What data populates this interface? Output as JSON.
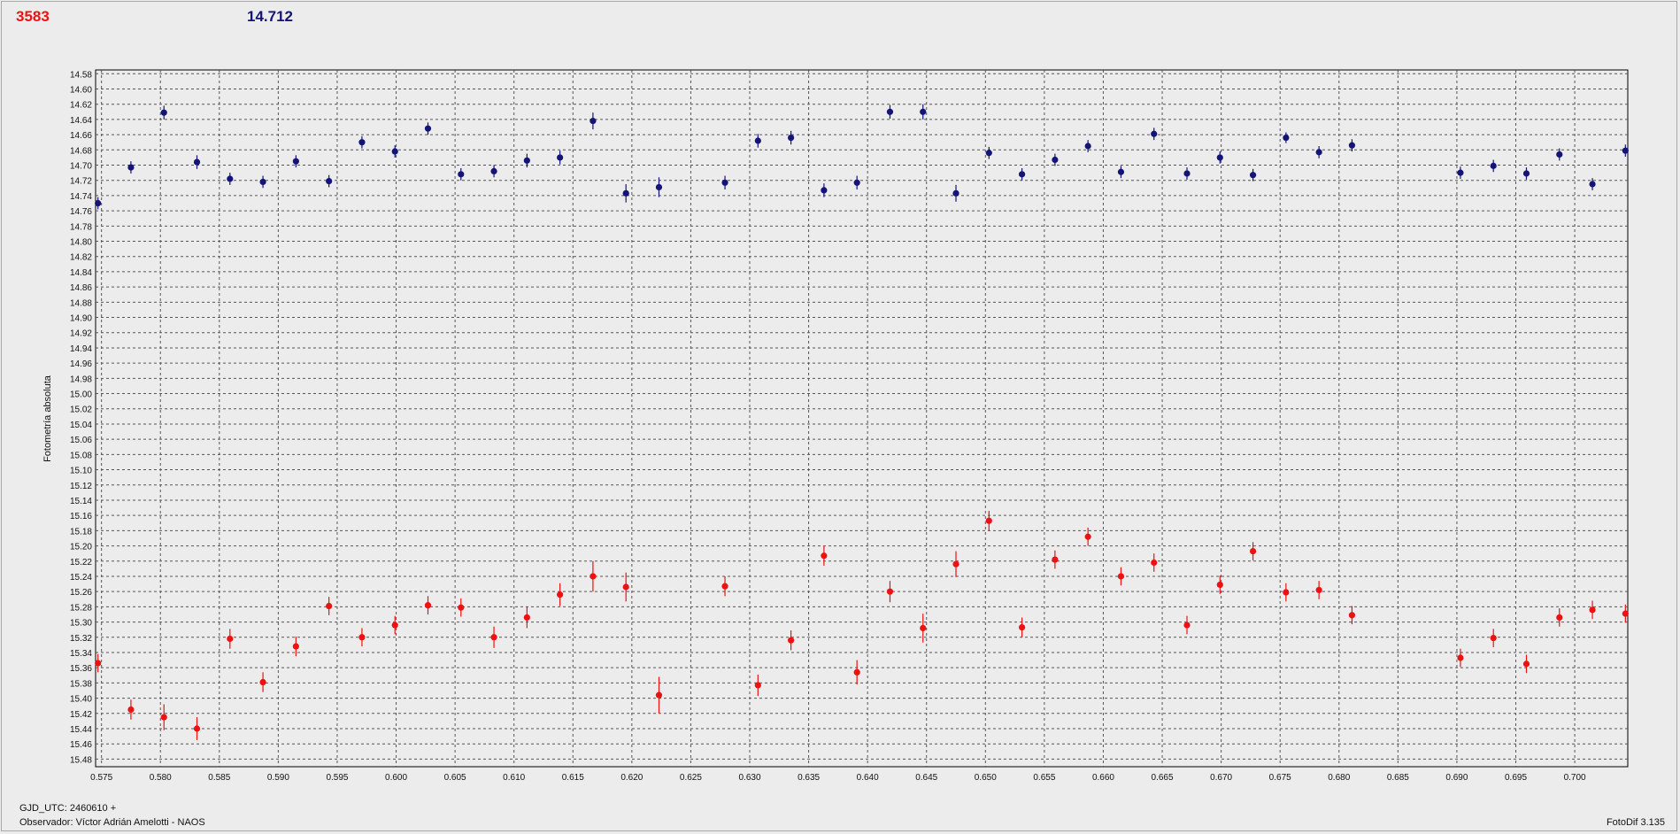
{
  "header": {
    "left_value": "3583",
    "right_value": "14.712"
  },
  "footer": {
    "gjd": "GJD_UTC: 2460610 +",
    "observer": "Observador: Víctor Adrián Amelotti - NAOS",
    "version": "FotoDif 3.135"
  },
  "colors": {
    "series_blue": "#141478",
    "series_red": "#ee1111",
    "grid": "#555555",
    "background": "#ececec"
  },
  "chart_data": {
    "type": "scatter",
    "ylabel": "Fotometría absoluta",
    "xlabel": "",
    "xlim": [
      0.5745,
      0.7045
    ],
    "ylim": [
      15.49,
      14.575
    ],
    "y_inverted": true,
    "grid": true,
    "x_ticks": [
      0.575,
      0.58,
      0.585,
      0.59,
      0.595,
      0.6,
      0.605,
      0.61,
      0.615,
      0.62,
      0.625,
      0.63,
      0.635,
      0.64,
      0.645,
      0.65,
      0.655,
      0.66,
      0.665,
      0.67,
      0.675,
      0.68,
      0.685,
      0.69,
      0.695,
      0.7
    ],
    "x_tick_labels": [
      "0.575",
      "0.580",
      "0.585",
      "0.590",
      "0.595",
      "0.600",
      "0.605",
      "0.610",
      "0.615",
      "0.620",
      "0.625",
      "0.630",
      "0.635",
      "0.640",
      "0.645",
      "0.650",
      "0.655",
      "0.660",
      "0.665",
      "0.670",
      "0.675",
      "0.680",
      "0.685",
      "0.690",
      "0.695",
      "0.700"
    ],
    "y_ticks": [
      14.58,
      14.6,
      14.62,
      14.64,
      14.66,
      14.68,
      14.7,
      14.72,
      14.74,
      14.76,
      14.78,
      14.8,
      14.82,
      14.84,
      14.86,
      14.88,
      14.9,
      14.92,
      14.94,
      14.96,
      14.98,
      15.0,
      15.02,
      15.04,
      15.06,
      15.08,
      15.1,
      15.12,
      15.14,
      15.16,
      15.18,
      15.2,
      15.22,
      15.24,
      15.26,
      15.28,
      15.3,
      15.32,
      15.34,
      15.36,
      15.38,
      15.4,
      15.42,
      15.44,
      15.46,
      15.48
    ],
    "y_tick_labels": [
      "14.58",
      "14.60",
      "14.62",
      "14.64",
      "14.66",
      "14.68",
      "14.70",
      "14.72",
      "14.74",
      "14.76",
      "14.78",
      "14.80",
      "14.82",
      "14.84",
      "14.86",
      "14.88",
      "14.90",
      "14.92",
      "14.94",
      "14.96",
      "14.98",
      "15.00",
      "15.02",
      "15.04",
      "15.06",
      "15.08",
      "15.10",
      "15.12",
      "15.14",
      "15.16",
      "15.18",
      "15.20",
      "15.22",
      "15.24",
      "15.26",
      "15.28",
      "15.30",
      "15.32",
      "15.34",
      "15.36",
      "15.38",
      "15.40",
      "15.42",
      "15.44",
      "15.46",
      "15.48"
    ],
    "series": [
      {
        "color": "#141478",
        "points": [
          {
            "x": 0.5747,
            "y": 14.75,
            "err": 0.008
          },
          {
            "x": 0.5775,
            "y": 14.703,
            "err": 0.008
          },
          {
            "x": 0.5803,
            "y": 14.631,
            "err": 0.009
          },
          {
            "x": 0.5831,
            "y": 14.696,
            "err": 0.009
          },
          {
            "x": 0.5859,
            "y": 14.718,
            "err": 0.008
          },
          {
            "x": 0.5887,
            "y": 14.722,
            "err": 0.008
          },
          {
            "x": 0.5915,
            "y": 14.695,
            "err": 0.008
          },
          {
            "x": 0.5943,
            "y": 14.721,
            "err": 0.008
          },
          {
            "x": 0.5971,
            "y": 14.67,
            "err": 0.008
          },
          {
            "x": 0.5999,
            "y": 14.682,
            "err": 0.008
          },
          {
            "x": 0.6027,
            "y": 14.652,
            "err": 0.008
          },
          {
            "x": 0.6055,
            "y": 14.712,
            "err": 0.008
          },
          {
            "x": 0.6083,
            "y": 14.708,
            "err": 0.008
          },
          {
            "x": 0.6111,
            "y": 14.694,
            "err": 0.009
          },
          {
            "x": 0.6139,
            "y": 14.69,
            "err": 0.009
          },
          {
            "x": 0.6167,
            "y": 14.642,
            "err": 0.011
          },
          {
            "x": 0.6195,
            "y": 14.737,
            "err": 0.012
          },
          {
            "x": 0.6223,
            "y": 14.729,
            "err": 0.013
          },
          {
            "x": 0.6279,
            "y": 14.723,
            "err": 0.009
          },
          {
            "x": 0.6307,
            "y": 14.668,
            "err": 0.009
          },
          {
            "x": 0.6335,
            "y": 14.664,
            "err": 0.009
          },
          {
            "x": 0.6363,
            "y": 14.733,
            "err": 0.009
          },
          {
            "x": 0.6391,
            "y": 14.723,
            "err": 0.009
          },
          {
            "x": 0.6419,
            "y": 14.63,
            "err": 0.009
          },
          {
            "x": 0.6447,
            "y": 14.63,
            "err": 0.01
          },
          {
            "x": 0.6475,
            "y": 14.737,
            "err": 0.011
          },
          {
            "x": 0.6503,
            "y": 14.684,
            "err": 0.008
          },
          {
            "x": 0.6531,
            "y": 14.712,
            "err": 0.008
          },
          {
            "x": 0.6559,
            "y": 14.693,
            "err": 0.008
          },
          {
            "x": 0.6587,
            "y": 14.675,
            "err": 0.008
          },
          {
            "x": 0.6615,
            "y": 14.709,
            "err": 0.008
          },
          {
            "x": 0.6643,
            "y": 14.659,
            "err": 0.008
          },
          {
            "x": 0.6671,
            "y": 14.711,
            "err": 0.008
          },
          {
            "x": 0.6699,
            "y": 14.69,
            "err": 0.008
          },
          {
            "x": 0.6727,
            "y": 14.713,
            "err": 0.008
          },
          {
            "x": 0.6755,
            "y": 14.664,
            "err": 0.007
          },
          {
            "x": 0.6783,
            "y": 14.683,
            "err": 0.008
          },
          {
            "x": 0.6811,
            "y": 14.674,
            "err": 0.008
          },
          {
            "x": 0.6903,
            "y": 14.71,
            "err": 0.008
          },
          {
            "x": 0.6931,
            "y": 14.701,
            "err": 0.008
          },
          {
            "x": 0.6959,
            "y": 14.711,
            "err": 0.008
          },
          {
            "x": 0.6987,
            "y": 14.686,
            "err": 0.008
          },
          {
            "x": 0.7015,
            "y": 14.725,
            "err": 0.008
          },
          {
            "x": 0.7043,
            "y": 14.681,
            "err": 0.008
          }
        ]
      },
      {
        "color": "#ee1111",
        "points": [
          {
            "x": 0.5747,
            "y": 15.354,
            "err": 0.012
          },
          {
            "x": 0.5775,
            "y": 15.415,
            "err": 0.013
          },
          {
            "x": 0.5803,
            "y": 15.425,
            "err": 0.017
          },
          {
            "x": 0.5831,
            "y": 15.44,
            "err": 0.015
          },
          {
            "x": 0.5859,
            "y": 15.322,
            "err": 0.013
          },
          {
            "x": 0.5887,
            "y": 15.379,
            "err": 0.013
          },
          {
            "x": 0.5915,
            "y": 15.332,
            "err": 0.013
          },
          {
            "x": 0.5943,
            "y": 15.279,
            "err": 0.012
          },
          {
            "x": 0.5971,
            "y": 15.32,
            "err": 0.012
          },
          {
            "x": 0.5999,
            "y": 15.304,
            "err": 0.012
          },
          {
            "x": 0.6027,
            "y": 15.278,
            "err": 0.012
          },
          {
            "x": 0.6055,
            "y": 15.281,
            "err": 0.012
          },
          {
            "x": 0.6083,
            "y": 15.32,
            "err": 0.014
          },
          {
            "x": 0.6111,
            "y": 15.294,
            "err": 0.014
          },
          {
            "x": 0.6139,
            "y": 15.264,
            "err": 0.015
          },
          {
            "x": 0.6167,
            "y": 15.24,
            "err": 0.02
          },
          {
            "x": 0.6195,
            "y": 15.254,
            "err": 0.019
          },
          {
            "x": 0.6223,
            "y": 15.396,
            "err": 0.024
          },
          {
            "x": 0.6279,
            "y": 15.253,
            "err": 0.013
          },
          {
            "x": 0.6307,
            "y": 15.383,
            "err": 0.014
          },
          {
            "x": 0.6335,
            "y": 15.324,
            "err": 0.013
          },
          {
            "x": 0.6363,
            "y": 15.213,
            "err": 0.013
          },
          {
            "x": 0.6391,
            "y": 15.366,
            "err": 0.016
          },
          {
            "x": 0.6419,
            "y": 15.26,
            "err": 0.014
          },
          {
            "x": 0.6447,
            "y": 15.308,
            "err": 0.019
          },
          {
            "x": 0.6475,
            "y": 15.224,
            "err": 0.017
          },
          {
            "x": 0.6503,
            "y": 15.167,
            "err": 0.013
          },
          {
            "x": 0.6531,
            "y": 15.307,
            "err": 0.013
          },
          {
            "x": 0.6559,
            "y": 15.218,
            "err": 0.012
          },
          {
            "x": 0.6587,
            "y": 15.188,
            "err": 0.012
          },
          {
            "x": 0.6615,
            "y": 15.24,
            "err": 0.012
          },
          {
            "x": 0.6643,
            "y": 15.222,
            "err": 0.012
          },
          {
            "x": 0.6671,
            "y": 15.304,
            "err": 0.012
          },
          {
            "x": 0.6699,
            "y": 15.251,
            "err": 0.012
          },
          {
            "x": 0.6727,
            "y": 15.207,
            "err": 0.012
          },
          {
            "x": 0.6755,
            "y": 15.261,
            "err": 0.012
          },
          {
            "x": 0.6783,
            "y": 15.258,
            "err": 0.012
          },
          {
            "x": 0.6811,
            "y": 15.291,
            "err": 0.012
          },
          {
            "x": 0.6903,
            "y": 15.347,
            "err": 0.012
          },
          {
            "x": 0.6931,
            "y": 15.321,
            "err": 0.012
          },
          {
            "x": 0.6959,
            "y": 15.355,
            "err": 0.012
          },
          {
            "x": 0.6987,
            "y": 15.294,
            "err": 0.012
          },
          {
            "x": 0.7015,
            "y": 15.284,
            "err": 0.012
          },
          {
            "x": 0.7043,
            "y": 15.289,
            "err": 0.012
          }
        ]
      }
    ]
  }
}
